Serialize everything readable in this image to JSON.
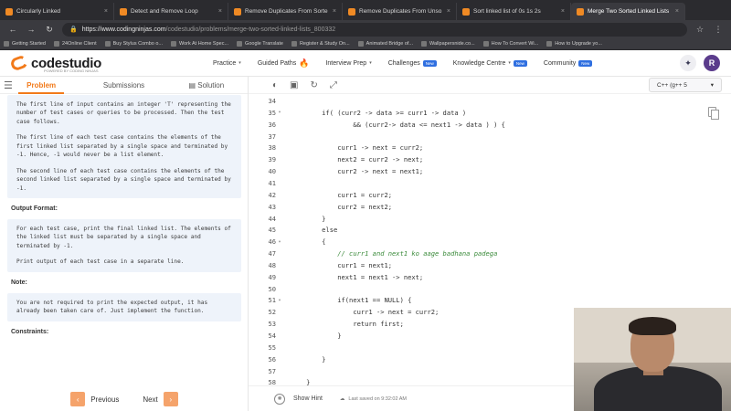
{
  "browser": {
    "tabs": [
      {
        "title": "Circularly Linked",
        "active": false
      },
      {
        "title": "Detect and Remove Loop",
        "active": false
      },
      {
        "title": "Remove Duplicates From Sorte",
        "active": false
      },
      {
        "title": "Remove Duplicates From Unso",
        "active": false
      },
      {
        "title": "Sort linked list of 0s 1s 2s",
        "active": false
      },
      {
        "title": "Merge Two Sorted Linked Lists",
        "active": true
      }
    ],
    "url_host": "https://www.codingninjas.com",
    "url_path": "/codestudio/problems/merge-two-sorted-linked-lists_800332",
    "bookmarks": [
      "Getting Started",
      "24Online Client",
      "Buy Stylus Combo o...",
      "Work At Home Spec...",
      "Google Translate",
      "Register & Study On...",
      "Animated Bridge of...",
      "Wallpapersnide.co...",
      "How To Convert Wi...",
      "How to Upgrade yo..."
    ]
  },
  "header": {
    "logo_text": "codestudio",
    "logo_sub": "POWERED BY CODING NINJAS",
    "nav": [
      {
        "label": "Practice",
        "caret": true,
        "badge": "",
        "flame": false
      },
      {
        "label": "Guided Paths",
        "caret": false,
        "badge": "",
        "flame": true
      },
      {
        "label": "Interview Prep",
        "caret": true,
        "badge": "",
        "flame": false
      },
      {
        "label": "Challenges",
        "caret": false,
        "badge": "New",
        "flame": false
      },
      {
        "label": "Knowledge Centre",
        "caret": true,
        "badge": "New",
        "flame": false
      },
      {
        "label": "Community",
        "caret": false,
        "badge": "New",
        "flame": false
      }
    ],
    "avatar_letter": "R"
  },
  "left": {
    "tabs": [
      "Problem",
      "Submissions",
      "Solution"
    ],
    "input_paragraphs": [
      "The first line of input contains an integer 'T' representing the number of test cases or queries to be processed. Then the test case follows.",
      "The first line of each test case contains the elements of the first linked list separated by a single space and terminated by -1. Hence, -1 would never be a list element.",
      "The second line of each test case contains the elements of the second linked list separated by a single space and terminated by -1."
    ],
    "output_heading": "Output Format:",
    "output_paragraphs": [
      "For each test case, print the final linked list. The elements of the linked list must be separated by a single space and terminated by -1.",
      "Print output of each test case in a separate line."
    ],
    "note_heading": "Note:",
    "note_paragraphs": [
      "You are not required to print the expected output, it has already been taken care of. Just implement the function."
    ],
    "constraints_heading": "Constraints:",
    "prev_label": "Previous",
    "next_label": "Next"
  },
  "editor": {
    "language": "C++ (g++ 5",
    "lines": [
      {
        "n": "34",
        "fold": "",
        "code": "",
        "comment": false
      },
      {
        "n": "35",
        "fold": "▾",
        "code": "        if( (curr2 -> data >= curr1 -> data )",
        "comment": false
      },
      {
        "n": "36",
        "fold": "",
        "code": "                && (curr2-> data <= next1 -> data ) ) {",
        "comment": false
      },
      {
        "n": "37",
        "fold": "",
        "code": "",
        "comment": false
      },
      {
        "n": "38",
        "fold": "",
        "code": "            curr1 -> next = curr2;",
        "comment": false
      },
      {
        "n": "39",
        "fold": "",
        "code": "            next2 = curr2 -> next;",
        "comment": false
      },
      {
        "n": "40",
        "fold": "",
        "code": "            curr2 -> next = next1;",
        "comment": false
      },
      {
        "n": "41",
        "fold": "",
        "code": "",
        "comment": false
      },
      {
        "n": "42",
        "fold": "",
        "code": "            curr1 = curr2;",
        "comment": false
      },
      {
        "n": "43",
        "fold": "",
        "code": "            curr2 = next2;",
        "comment": false
      },
      {
        "n": "44",
        "fold": "",
        "code": "        }",
        "comment": false
      },
      {
        "n": "45",
        "fold": "",
        "code": "        else",
        "comment": false
      },
      {
        "n": "46",
        "fold": "▾",
        "code": "        {",
        "comment": false
      },
      {
        "n": "47",
        "fold": "",
        "code": "            // curr1 and next1 ko aage badhana padega",
        "comment": true
      },
      {
        "n": "48",
        "fold": "",
        "code": "            curr1 = next1;",
        "comment": false
      },
      {
        "n": "49",
        "fold": "",
        "code": "            next1 = next1 -> next;",
        "comment": false
      },
      {
        "n": "50",
        "fold": "",
        "code": "",
        "comment": false
      },
      {
        "n": "51",
        "fold": "▾",
        "code": "            if(next1 == NULL) {",
        "comment": false
      },
      {
        "n": "52",
        "fold": "",
        "code": "                curr1 -> next = curr2;",
        "comment": false
      },
      {
        "n": "53",
        "fold": "",
        "code": "                return first;",
        "comment": false
      },
      {
        "n": "54",
        "fold": "",
        "code": "            }",
        "comment": false
      },
      {
        "n": "55",
        "fold": "",
        "code": "",
        "comment": false
      },
      {
        "n": "56",
        "fold": "",
        "code": "        }",
        "comment": false
      },
      {
        "n": "57",
        "fold": "",
        "code": "",
        "comment": false
      },
      {
        "n": "58",
        "fold": "",
        "code": "    }",
        "comment": false
      }
    ],
    "show_hint_label": "Show Hint",
    "saved_text": "Last saved on 9:32:02 AM"
  }
}
